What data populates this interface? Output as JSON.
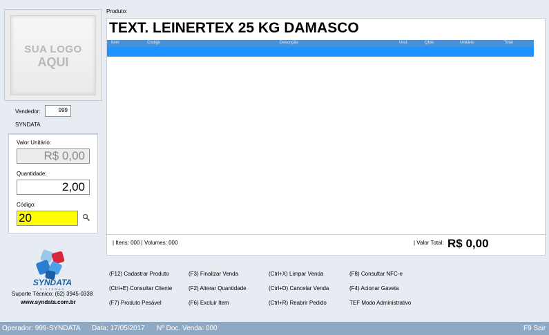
{
  "logo_placeholder": {
    "line1": "SUA LOGO",
    "line2": "AQUI"
  },
  "vendor": {
    "label": "Vendedor:",
    "code": "999",
    "name": "SYNDATA"
  },
  "unit_value": {
    "label": "Valor Unitário:",
    "value": "R$ 0,00"
  },
  "quantity": {
    "label": "Quantidade:",
    "value": "2,00"
  },
  "code": {
    "label": "Código:",
    "value": "20"
  },
  "product": {
    "label": "Produto:",
    "name": "TEXT. LEINERTEX 25 KG DAMASCO"
  },
  "table": {
    "columns": [
      "Item",
      "Código",
      "Descrição",
      "Und.",
      "Qtde.",
      "Unitário",
      "Total"
    ]
  },
  "footer": {
    "items_text": "| Itens: 000 | Volumes: 000",
    "total_label": "| Valor Total:",
    "total_value": "R$ 0,00"
  },
  "brand": {
    "name": "SYNDATA",
    "support": "Suporte Técnico: (62) 3945-0338",
    "url": "www.syndata.com.br"
  },
  "shortcuts": [
    "(F12) Cadastrar Produto",
    "(F3) Finalizar Venda",
    "(Ctrl+X) Limpar Venda",
    "(F8) Consultar NFC-e",
    "(Ctrl+E) Consultar Cliente",
    "(F2) Alterar Quantidade",
    "(Ctrl+D) Cancelar Venda",
    "(F4) Acionar Gaveta",
    "(F7) Produto Pesável",
    "(F6) Excluir Item",
    "(Ctrl+R) Reabrir Pedido",
    "TEF Modo Administrativo"
  ],
  "status_bar": {
    "operator": "Operador: 999-SYNDATA",
    "date": "Data: 17/05/2017",
    "doc": "Nº Doc. Venda: 000",
    "exit": "F9 Sair"
  }
}
